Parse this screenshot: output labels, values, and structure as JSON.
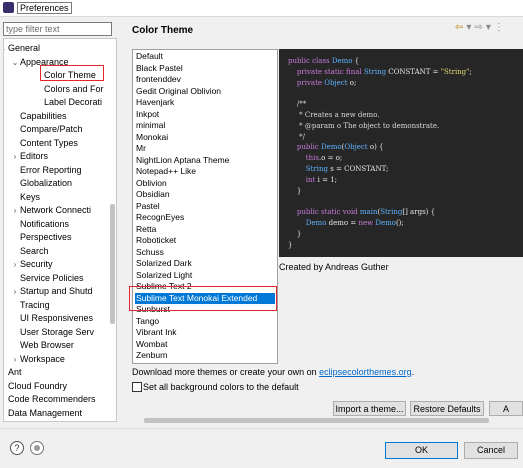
{
  "window": {
    "title": "Preferences"
  },
  "filter": {
    "placeholder": "type filter text"
  },
  "tree": [
    {
      "label": "General",
      "level": 0,
      "expanded": true
    },
    {
      "label": "Appearance",
      "level": 1,
      "expanded": true
    },
    {
      "label": "Color Theme",
      "level": 2
    },
    {
      "label": "Colors and For",
      "level": 2
    },
    {
      "label": "Label Decorati",
      "level": 2
    },
    {
      "label": "Capabilities",
      "level": 1
    },
    {
      "label": "Compare/Patch",
      "level": 1
    },
    {
      "label": "Content Types",
      "level": 1
    },
    {
      "label": "Editors",
      "level": 1,
      "expanded": false
    },
    {
      "label": "Error Reporting",
      "level": 1
    },
    {
      "label": "Globalization",
      "level": 1
    },
    {
      "label": "Keys",
      "level": 1
    },
    {
      "label": "Network Connecti",
      "level": 1,
      "expanded": false
    },
    {
      "label": "Notifications",
      "level": 1
    },
    {
      "label": "Perspectives",
      "level": 1
    },
    {
      "label": "Search",
      "level": 1
    },
    {
      "label": "Security",
      "level": 1,
      "expanded": false
    },
    {
      "label": "Service Policies",
      "level": 1
    },
    {
      "label": "Startup and Shutd",
      "level": 1,
      "expanded": false
    },
    {
      "label": "Tracing",
      "level": 1
    },
    {
      "label": "UI Responsivenes",
      "level": 1
    },
    {
      "label": "User Storage Serv",
      "level": 1
    },
    {
      "label": "Web Browser",
      "level": 1
    },
    {
      "label": "Workspace",
      "level": 1,
      "expanded": false
    },
    {
      "label": "Ant",
      "level": 0,
      "expanded": false
    },
    {
      "label": "Cloud Foundry",
      "level": 0,
      "expanded": false
    },
    {
      "label": "Code Recommenders",
      "level": 0,
      "expanded": false
    },
    {
      "label": "Data Management",
      "level": 0,
      "expanded": false
    }
  ],
  "page": {
    "title": "Color Theme"
  },
  "themes": [
    "Default",
    "Black Pastel",
    "frontenddev",
    "Gedit Original Oblivion",
    "Havenjark",
    "Inkpot",
    "minimal",
    "Monokai",
    "Mr",
    "NightLion Aptana Theme",
    "Notepad++ Like",
    "Oblivion",
    "Obsidian",
    "Pastel",
    "RecognEyes",
    "Retta",
    "Roboticket",
    "Schuss",
    "Solarized Dark",
    "Solarized Light",
    "Sublime Text 2",
    "Sublime Text Monokai Extended",
    "Sunburst",
    "Tango",
    "Vibrant Ink",
    "Wombat",
    "Zenburn"
  ],
  "selected_theme": "Sublime Text Monokai Extended",
  "preview": {
    "lines": [
      [
        [
          "kw",
          "public class "
        ],
        [
          "ty",
          "Demo"
        ],
        [
          "pl",
          " {"
        ]
      ],
      [
        [
          "kw",
          "    private static final "
        ],
        [
          "ty",
          "String"
        ],
        [
          "pl",
          " CONSTANT = "
        ],
        [
          "st",
          "\"String\""
        ],
        [
          "pl",
          ";"
        ]
      ],
      [
        [
          "kw",
          "    private "
        ],
        [
          "ty",
          "Object"
        ],
        [
          "pl",
          " o;"
        ]
      ],
      [
        [
          "pl",
          ""
        ]
      ],
      [
        [
          "cm",
          "    /**"
        ]
      ],
      [
        [
          "cm",
          "     * Creates a new demo."
        ]
      ],
      [
        [
          "cm",
          "     * @param o The object to demonstrate."
        ]
      ],
      [
        [
          "cm",
          "     */"
        ]
      ],
      [
        [
          "kw",
          "    public "
        ],
        [
          "ty",
          "Demo"
        ],
        [
          "pl",
          "("
        ],
        [
          "ty",
          "Object"
        ],
        [
          "pl",
          " o) {"
        ]
      ],
      [
        [
          "kw",
          "        this"
        ],
        [
          "pl",
          ".o = o;"
        ]
      ],
      [
        [
          "ty",
          "        String"
        ],
        [
          "pl",
          " s = CONSTANT;"
        ]
      ],
      [
        [
          "kw",
          "        int"
        ],
        [
          "pl",
          " i = 1;"
        ]
      ],
      [
        [
          "pl",
          "    }"
        ]
      ],
      [
        [
          "pl",
          ""
        ]
      ],
      [
        [
          "kw",
          "    public static void "
        ],
        [
          "ty",
          "main"
        ],
        [
          "pl",
          "("
        ],
        [
          "ty",
          "String"
        ],
        [
          "pl",
          "[] args) {"
        ]
      ],
      [
        [
          "ty",
          "        Demo"
        ],
        [
          "pl",
          " demo = "
        ],
        [
          "kw",
          "new "
        ],
        [
          "ty",
          "Demo"
        ],
        [
          "pl",
          "();"
        ]
      ],
      [
        [
          "pl",
          "    }"
        ]
      ],
      [
        [
          "pl",
          "}"
        ]
      ]
    ]
  },
  "created_by": "Created by Andreas Guther",
  "download": {
    "text": "Download more themes or create your own on ",
    "link": "eclipsecolorthemes.org",
    "suffix": "."
  },
  "checkbox": {
    "label": "Set all background colors to the default",
    "checked": false
  },
  "buttons": {
    "import": "Import a theme...",
    "restore": "Restore Defaults",
    "apply": "A",
    "ok": "OK",
    "cancel": "Cancel"
  },
  "icons": {
    "help": "help-icon",
    "record": "record-macro-icon",
    "back": "back-arrow-icon",
    "forward": "forward-arrow-icon",
    "menu": "view-menu-icon"
  }
}
